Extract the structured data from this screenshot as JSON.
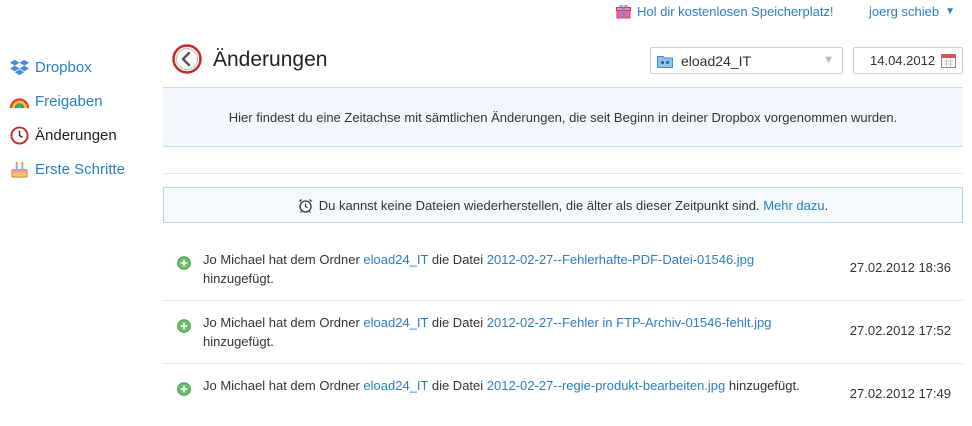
{
  "topbar": {
    "promo_label": "Hol dir kostenlosen Speicherplatz!",
    "promo_icon": "gift-icon",
    "user_name": "joerg schieb",
    "user_menu_icon": "caret-down-icon"
  },
  "sidebar": {
    "items": [
      {
        "label": "Dropbox",
        "icon": "dropbox-icon",
        "active": false
      },
      {
        "label": "Freigaben",
        "icon": "rainbow-icon",
        "active": false
      },
      {
        "label": "Änderungen",
        "icon": "clock-icon",
        "active": true
      },
      {
        "label": "Erste Schritte",
        "icon": "cake-icon",
        "active": false
      }
    ]
  },
  "header": {
    "title": "Änderungen",
    "back_icon": "back-arrow-icon",
    "folder_select": {
      "value": "eload24_IT",
      "icon": "shared-folder-icon"
    },
    "date": {
      "value": "14.04.2012",
      "icon": "calendar-icon"
    }
  },
  "info_text": "Hier findest du eine Zeitachse mit sämtlichen Änderungen, die seit Beginn in deiner Dropbox vorgenommen wurden.",
  "warning": {
    "icon": "alarm-clock-icon",
    "text": "Du kannst keine Dateien wiederherstellen, die älter als dieser Zeitpunkt sind.",
    "link": "Mehr dazu",
    "suffix": "."
  },
  "events": [
    {
      "prefix": "Jo Michael hat dem Ordner ",
      "folder": "eload24_IT",
      "middle": " die Datei ",
      "file": "2012-02-27--Fehlerhafte-PDF-Datei-01546.jpg",
      "suffix": " hinzugefügt.",
      "time": "27.02.2012 18:36"
    },
    {
      "prefix": "Jo Michael hat dem Ordner ",
      "folder": "eload24_IT",
      "middle": " die Datei ",
      "file": "2012-02-27--Fehler in FTP-Archiv-01546-fehlt.jpg",
      "suffix": " hinzugefügt.",
      "time": "27.02.2012 17:52"
    },
    {
      "prefix": "Jo Michael hat dem Ordner ",
      "folder": "eload24_IT",
      "middle": " die Datei ",
      "file": "2012-02-27--regie-produkt-bearbeiten.jpg",
      "suffix": " hinzugefügt.",
      "time": "27.02.2012 17:49"
    }
  ],
  "colors": {
    "link": "#2a7fc4",
    "info_bg": "#f1f7fc",
    "add_icon": "#5cb85c"
  }
}
